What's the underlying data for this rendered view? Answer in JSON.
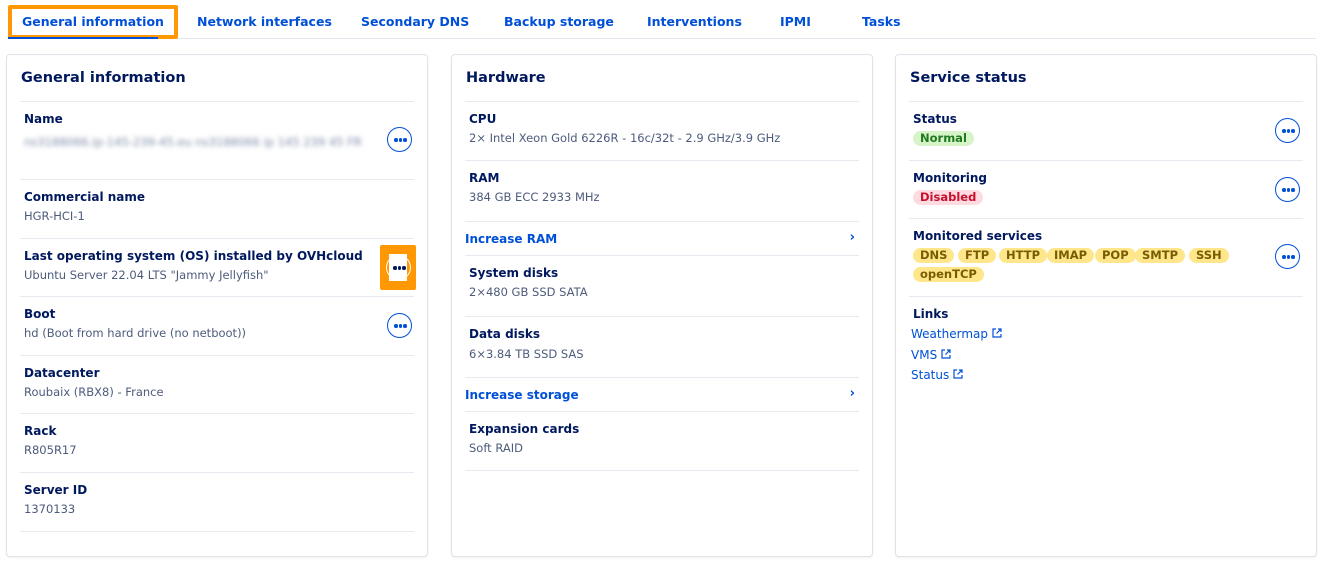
{
  "tabs": [
    {
      "label": "General information",
      "active": true
    },
    {
      "label": "Network interfaces"
    },
    {
      "label": "Secondary DNS"
    },
    {
      "label": "Backup storage"
    },
    {
      "label": "Interventions"
    },
    {
      "label": "IPMI"
    },
    {
      "label": "Tasks"
    }
  ],
  "general": {
    "title": "General information",
    "name_label": "Name",
    "name_value_blurred": "ns3188066.ip-145-239-45.eu ns3188066 ip 145 239 45 FR",
    "commercial_label": "Commercial name",
    "commercial_value": "HGR-HCI-1",
    "os_label": "Last operating system (OS) installed by OVHcloud",
    "os_value": "Ubuntu Server 22.04 LTS \"Jammy Jellyfish\"",
    "boot_label": "Boot",
    "boot_value": "hd (Boot from hard drive (no netboot))",
    "datacenter_label": "Datacenter",
    "datacenter_value": "Roubaix (RBX8) - France",
    "rack_label": "Rack",
    "rack_value": "R805R17",
    "server_id_label": "Server ID",
    "server_id_value": "1370133"
  },
  "hardware": {
    "title": "Hardware",
    "cpu_label": "CPU",
    "cpu_value": "2× Intel Xeon Gold 6226R - 16c/32t - 2.9 GHz/3.9 GHz",
    "ram_label": "RAM",
    "ram_value": "384 GB ECC 2933 MHz",
    "increase_ram": "Increase RAM",
    "system_disks_label": "System disks",
    "system_disks_value": "2×480 GB SSD SATA",
    "data_disks_label": "Data disks",
    "data_disks_value": "6×3.84 TB SSD SAS",
    "increase_storage": "Increase storage",
    "expansion_label": "Expansion cards",
    "expansion_value": "Soft RAID"
  },
  "service": {
    "title": "Service status",
    "status_label": "Status",
    "status_value": "Normal",
    "monitoring_label": "Monitoring",
    "monitoring_value": "Disabled",
    "monitored_label": "Monitored services",
    "monitored_services": [
      "DNS",
      "FTP",
      "HTTP",
      "IMAP",
      "POP",
      "SMTP",
      "SSH",
      "openTCP"
    ],
    "links_label": "Links",
    "links": [
      "Weathermap",
      "VMS",
      "Status"
    ]
  },
  "colors": {
    "accent": "#0050d7",
    "highlight": "#ff9803",
    "text": "#00185e"
  }
}
